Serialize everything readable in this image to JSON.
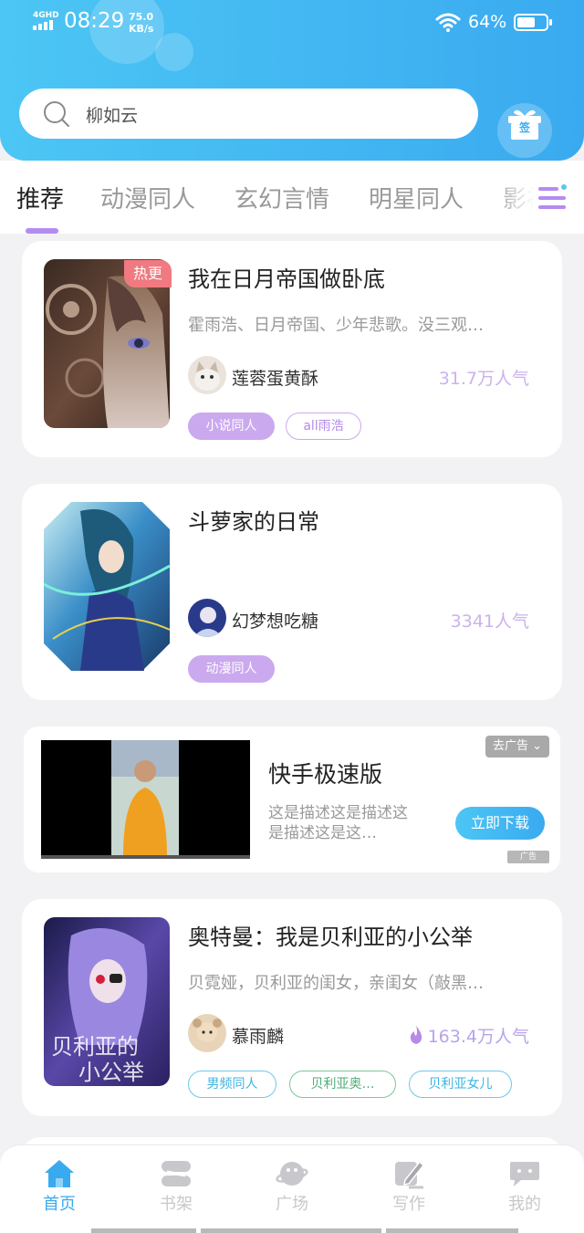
{
  "status_bar": {
    "network": "4GHD",
    "time": "08:29",
    "speed_value": "75.0",
    "speed_unit": "KB/s",
    "battery": "64%",
    "battery_level": 0.64
  },
  "search": {
    "query": "柳如云",
    "icon": "search-icon"
  },
  "sign_in": {
    "label": "签",
    "icon": "gift-icon"
  },
  "tabs": [
    {
      "label": "推荐",
      "active": true
    },
    {
      "label": "动漫同人"
    },
    {
      "label": "玄幻言情"
    },
    {
      "label": "明星同人"
    },
    {
      "label": "影视"
    }
  ],
  "cards": [
    {
      "badge": "热更",
      "title": "我在日月帝国做卧底",
      "desc": "霍雨浩、日月帝国、少年悲歌。没三观…",
      "author": "莲蓉蛋黄酥",
      "popularity": "31.7万人气",
      "tags": [
        "小说同人",
        "all雨浩"
      ]
    },
    {
      "title": "斗萝家的日常",
      "desc": "",
      "author": "幻梦想吃糖",
      "popularity": "3341人气",
      "tags": [
        "动漫同人"
      ]
    },
    {
      "title": "奥特曼：我是贝利亚的小公举",
      "desc": "贝霓娅，贝利亚的闺女，亲闺女（敲黑…",
      "author": "慕雨麟",
      "popularity": "163.4万人气",
      "popularity_icon": "flame-icon",
      "tags": [
        "男频同人",
        "贝利亚奥…",
        "贝利亚女儿"
      ]
    }
  ],
  "ad": {
    "title": "快手极速版",
    "desc": "这是描述这是描述这是描述这是这…",
    "close_label": "去广告",
    "cta": "立即下载",
    "mark": "广告"
  },
  "bottom_nav": [
    {
      "label": "首页",
      "icon": "home-icon",
      "active": true
    },
    {
      "label": "书架",
      "icon": "bookshelf-icon"
    },
    {
      "label": "广场",
      "icon": "planet-icon"
    },
    {
      "label": "写作",
      "icon": "pen-icon"
    },
    {
      "label": "我的",
      "icon": "chat-bubble-icon"
    }
  ],
  "colors": {
    "primary": "#3aaaf0",
    "accent": "#b48cf0",
    "hot": "#f07a80"
  }
}
